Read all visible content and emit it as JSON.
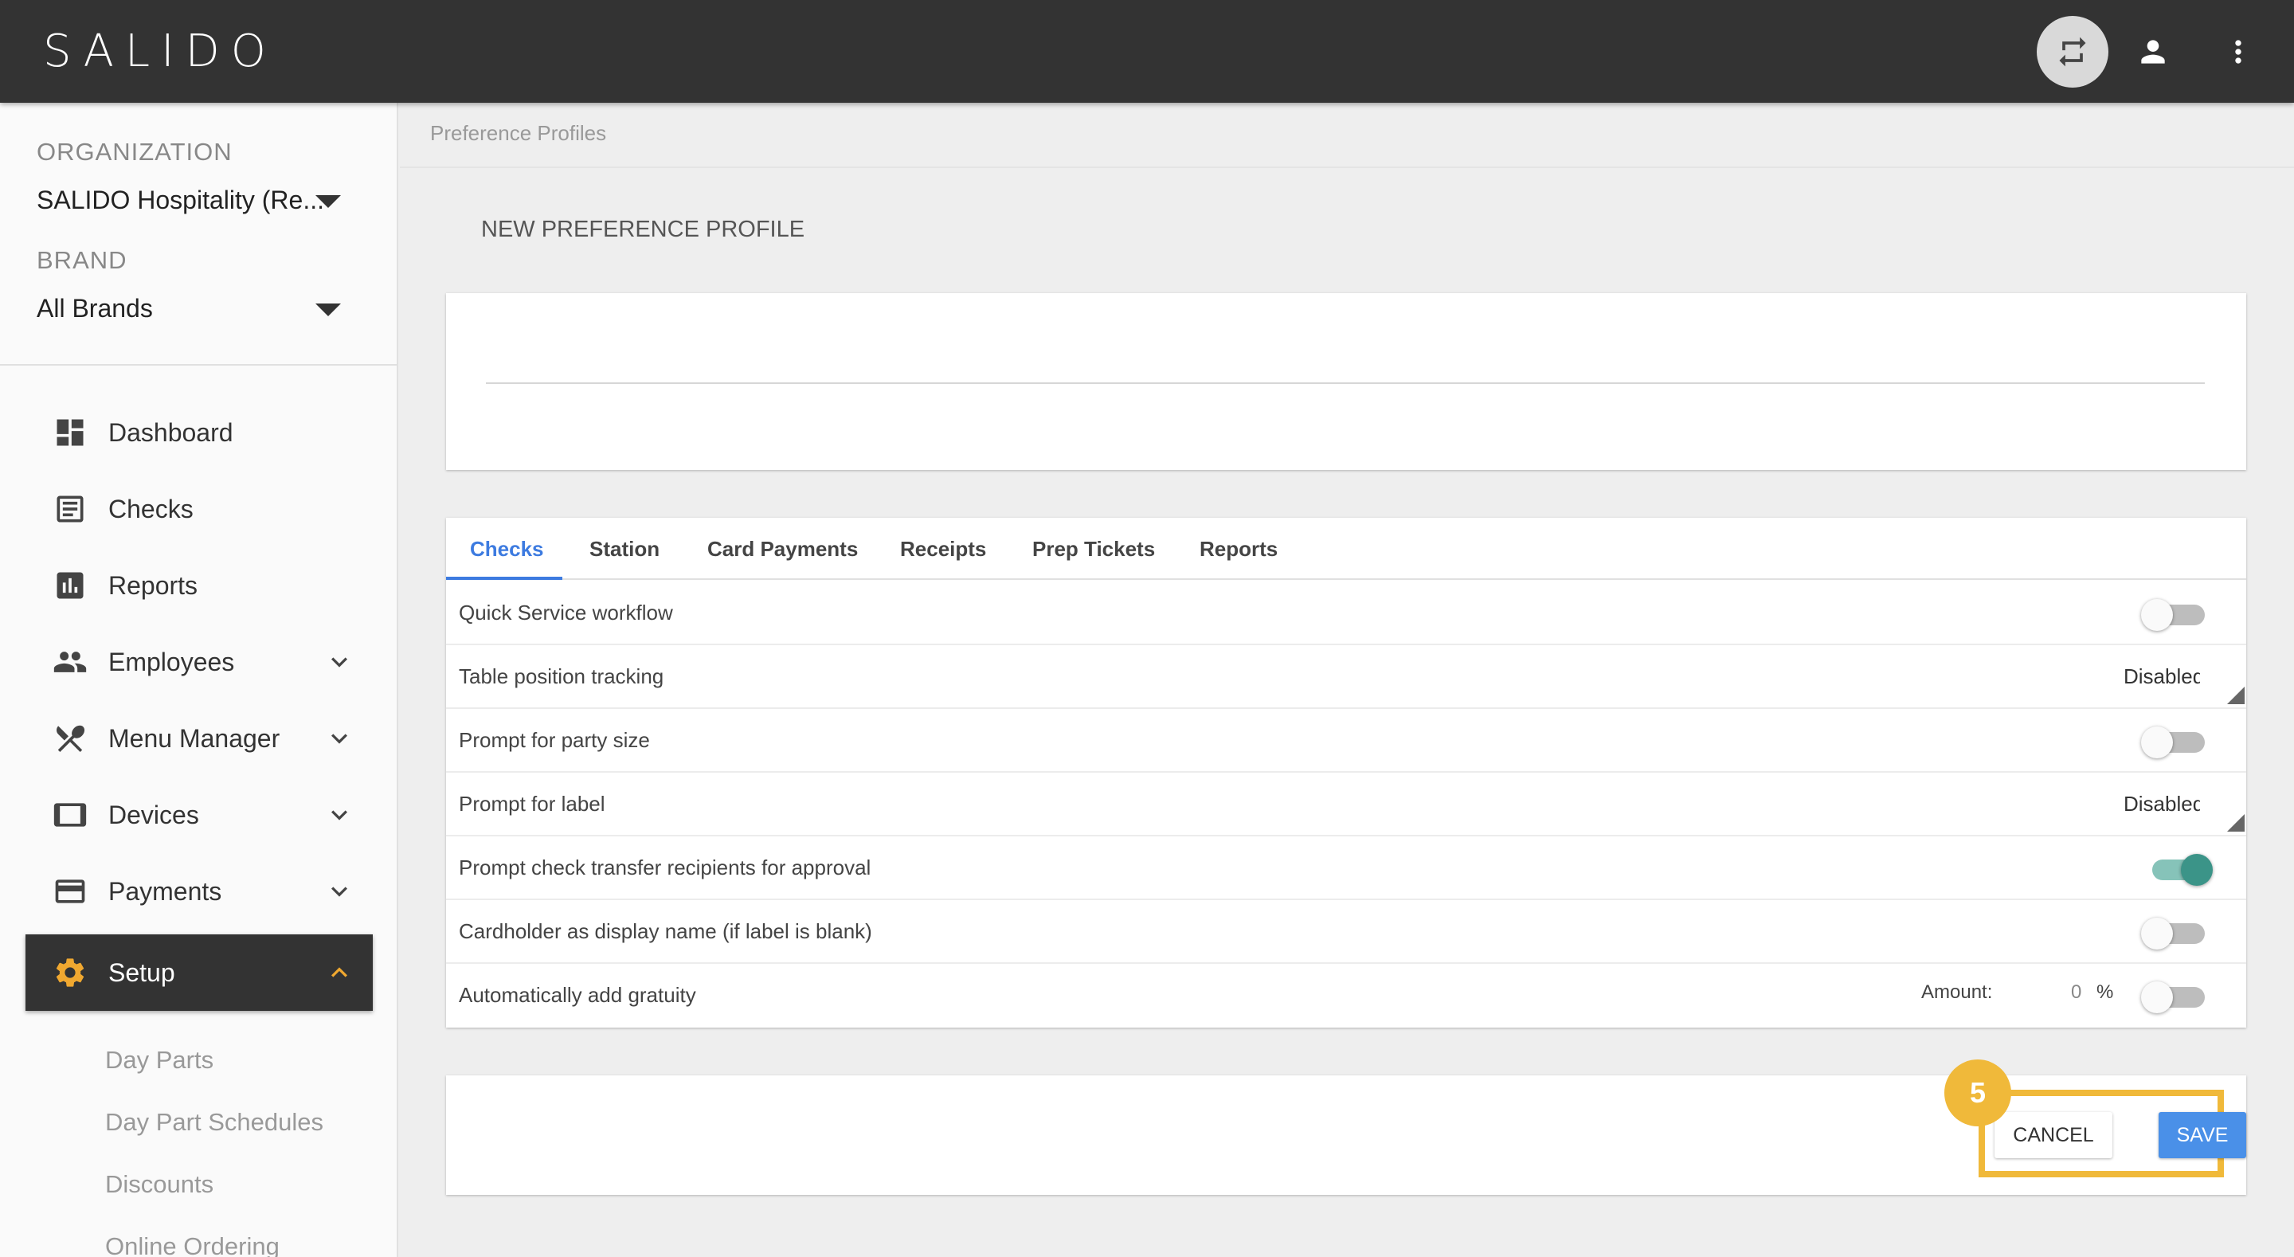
{
  "app": {
    "logo": "SALIDO"
  },
  "topbar": {
    "switch_icon": "swap-arrows-icon",
    "account_icon": "person-icon",
    "more_icon": "more-vertical-icon"
  },
  "sidebar": {
    "organization_label": "ORGANIZATION",
    "organization_value": "SALIDO Hospitality (Re...",
    "brand_label": "BRAND",
    "brand_value": "All Brands",
    "items": [
      {
        "label": "Dashboard",
        "icon": "dashboard-icon"
      },
      {
        "label": "Checks",
        "icon": "receipt-icon"
      },
      {
        "label": "Reports",
        "icon": "bar-chart-icon"
      },
      {
        "label": "Employees",
        "icon": "people-icon"
      },
      {
        "label": "Menu Manager",
        "icon": "utensils-icon"
      },
      {
        "label": "Devices",
        "icon": "tablet-icon"
      },
      {
        "label": "Payments",
        "icon": "credit-card-icon"
      },
      {
        "label": "Setup",
        "icon": "gear-icon"
      }
    ],
    "setup_subitems": [
      "Day Parts",
      "Day Part Schedules",
      "Discounts",
      "Online Ordering"
    ]
  },
  "main": {
    "breadcrumb": "Preference Profiles",
    "title": "NEW PREFERENCE PROFILE",
    "tabs": [
      {
        "label": "Checks"
      },
      {
        "label": "Station"
      },
      {
        "label": "Card Payments"
      },
      {
        "label": "Receipts"
      },
      {
        "label": "Prep Tickets"
      },
      {
        "label": "Reports"
      }
    ],
    "rows": [
      {
        "label": "Quick Service workflow",
        "toggle": "off"
      },
      {
        "label": "Table position tracking",
        "select": "Disabled"
      },
      {
        "label": "Prompt for party size",
        "toggle": "off"
      },
      {
        "label": "Prompt for label",
        "select": "Disabled"
      },
      {
        "label": "Prompt check transfer recipients for approval",
        "toggle": "on"
      },
      {
        "label": "Cardholder as display name (if label is blank)",
        "toggle": "off"
      },
      {
        "label": "Automatically add gratuity",
        "toggle": "off",
        "amount_label": "Amount:",
        "amount_value": "0",
        "amount_unit": "%"
      }
    ],
    "actions": {
      "step_number": "5",
      "cancel_label": "CANCEL",
      "save_label": "SAVE"
    }
  },
  "colors": {
    "topbar": "#333333",
    "accent": "#3d7be0",
    "save": "#4a90e8",
    "toggle_on": "#3b9488",
    "highlight": "#f0b93a",
    "setup_icon": "#f0a830"
  }
}
